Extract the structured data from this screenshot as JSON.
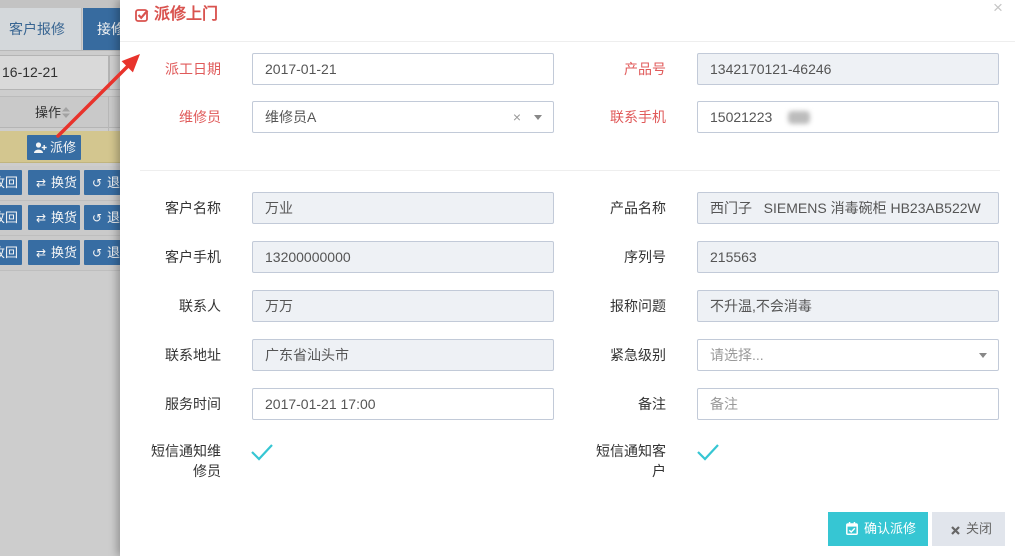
{
  "colors": {
    "title_red": "#d9534f",
    "required_label_red": "#e05a5a",
    "accent_teal": "#36c6d3",
    "readonly_bg": "#eef1f5",
    "primary_blue": "#3a72aa",
    "highlight_row": "#dccf95",
    "annotation_arrow_red": "#e8332c"
  },
  "background_page": {
    "tabs": [
      {
        "label": "客户报修",
        "active": false
      },
      {
        "label": "接修",
        "active": true
      }
    ],
    "date_filter": "16-12-21",
    "table": {
      "action_header": "操作",
      "header_icon": "sort-icon",
      "rows": [
        {
          "highlighted": true,
          "buttons": [
            {
              "icon": "user-plus-icon",
              "label": "派修"
            }
          ]
        },
        {
          "highlighted": false,
          "buttons": [
            {
              "label": "收回"
            },
            {
              "icon": "exchange-icon",
              "label": "换货"
            },
            {
              "icon": "undo-icon",
              "label": "退"
            }
          ]
        },
        {
          "highlighted": false,
          "buttons": [
            {
              "label": "收回"
            },
            {
              "icon": "exchange-icon",
              "label": "换货"
            },
            {
              "icon": "undo-icon",
              "label": "退"
            }
          ]
        },
        {
          "highlighted": false,
          "buttons": [
            {
              "label": "收回"
            },
            {
              "icon": "exchange-icon",
              "label": "换货"
            },
            {
              "icon": "undo-icon",
              "label": "退"
            }
          ]
        }
      ]
    }
  },
  "modal": {
    "title_icon": "check-square-icon",
    "title": "派修上门",
    "close_icon": "close-icon",
    "fields": {
      "dispatch_date": {
        "label": "派工日期",
        "value": "2017-01-21",
        "required": true
      },
      "product_no": {
        "label": "产品号",
        "value": "1342170121-46246",
        "required": true,
        "readonly": true
      },
      "technician": {
        "label": "维修员",
        "value": "维修员A",
        "required": true,
        "clear_icon": "clear-icon",
        "caret_icon": "caret-down-icon"
      },
      "contact_mobile": {
        "label": "联系手机",
        "value": "15021223",
        "required": true
      },
      "customer_name": {
        "label": "客户名称",
        "value": "万业",
        "readonly": true
      },
      "product_name": {
        "label": "产品名称",
        "value": "西门子   SIEMENS 消毒碗柜 HB23AB522W",
        "readonly": true
      },
      "customer_mobile": {
        "label": "客户手机",
        "value": "13200000000",
        "readonly": true
      },
      "serial_no": {
        "label": "序列号",
        "value": "215563",
        "readonly": true
      },
      "contact_person": {
        "label": "联系人",
        "value": "万万",
        "readonly": true
      },
      "reported_issue": {
        "label": "报称问题",
        "value": "不升温,不会消毒",
        "readonly": true
      },
      "contact_address": {
        "label": "联系地址",
        "value": "广东省汕头市",
        "readonly": true
      },
      "urgency": {
        "label": "紧急级别",
        "placeholder": "请选择...",
        "caret_icon": "caret-down-icon"
      },
      "service_time": {
        "label": "服务时间",
        "value": "2017-01-21 17:00"
      },
      "remark": {
        "label": "备注",
        "placeholder": "备注"
      },
      "sms_technician": {
        "label": "短信通知维修员",
        "checked": true,
        "check_icon": "check-icon"
      },
      "sms_customer": {
        "label": "短信通知客户",
        "checked": true,
        "check_icon": "check-icon"
      }
    },
    "footer": {
      "confirm": {
        "icon": "calendar-check-icon",
        "label": "确认派修"
      },
      "close": {
        "icon": "times-icon",
        "label": "关闭"
      }
    }
  }
}
